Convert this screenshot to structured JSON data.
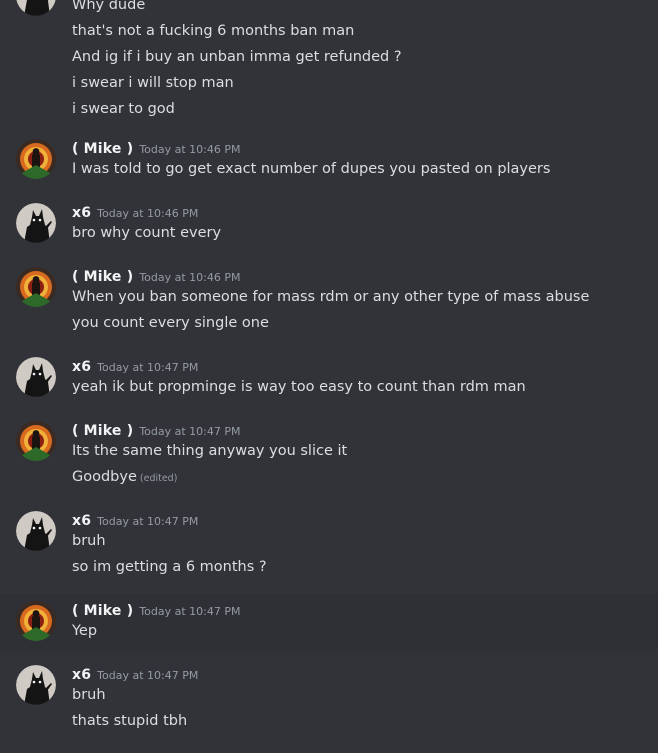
{
  "chat": {
    "continued_lines": [
      "Why dude",
      "that's not a fucking 6 months ban man",
      "And ig if i buy an unban imma get refunded ?",
      "i swear i will stop man",
      "i swear to god"
    ],
    "groups": [
      {
        "author": "( Mike )",
        "avatar": "mike-avatar",
        "timestamp": "Today at 10:46 PM",
        "highlighted": false,
        "messages": [
          {
            "text": "I was told to go get exact number of dupes you pasted on players"
          }
        ]
      },
      {
        "author": "x6",
        "avatar": "x6-avatar",
        "timestamp": "Today at 10:46 PM",
        "highlighted": false,
        "messages": [
          {
            "text": "bro why count every"
          }
        ]
      },
      {
        "author": "( Mike )",
        "avatar": "mike-avatar",
        "timestamp": "Today at 10:46 PM",
        "highlighted": false,
        "messages": [
          {
            "text": "When you ban someone for mass rdm or any other type of mass abuse"
          },
          {
            "text": "you count every single one"
          }
        ]
      },
      {
        "author": "x6",
        "avatar": "x6-avatar",
        "timestamp": "Today at 10:47 PM",
        "highlighted": false,
        "messages": [
          {
            "text": "yeah ik but propminge is way too easy to count than rdm man"
          }
        ]
      },
      {
        "author": "( Mike )",
        "avatar": "mike-avatar",
        "timestamp": "Today at 10:47 PM",
        "highlighted": false,
        "messages": [
          {
            "text": "Its the same thing anyway you slice it"
          },
          {
            "text": "Goodbye",
            "edited": "(edited)"
          }
        ]
      },
      {
        "author": "x6",
        "avatar": "x6-avatar",
        "timestamp": "Today at 10:47 PM",
        "highlighted": false,
        "messages": [
          {
            "text": "bruh"
          },
          {
            "text": "so im getting a 6 months ?"
          }
        ]
      },
      {
        "author": "( Mike )",
        "avatar": "mike-avatar",
        "timestamp": "Today at 10:47 PM",
        "highlighted": true,
        "messages": [
          {
            "text": "Yep"
          }
        ]
      },
      {
        "author": "x6",
        "avatar": "x6-avatar",
        "timestamp": "Today at 10:47 PM",
        "highlighted": false,
        "messages": [
          {
            "text": "bruh"
          },
          {
            "text": "thats stupid tbh"
          }
        ]
      }
    ]
  },
  "colors": {
    "background": "#313338",
    "highlight_row": "#2e3035",
    "username": "#f2f3f5",
    "message_text": "#dbdee1",
    "timestamp": "#949ba4"
  }
}
